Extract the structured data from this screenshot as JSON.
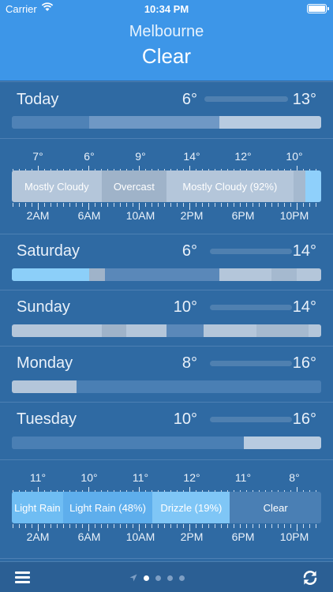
{
  "status_bar": {
    "carrier": "Carrier",
    "time": "10:34 PM"
  },
  "header": {
    "city": "Melbourne",
    "condition": "Clear"
  },
  "today": {
    "name": "Today",
    "low": "6°",
    "high": "13°",
    "bar": [
      {
        "frac": 0.25,
        "color": "#4f82b6"
      },
      {
        "frac": 0.42,
        "color": "#6f98c5"
      },
      {
        "frac": 0.33,
        "color": "#b8cbe0"
      }
    ]
  },
  "hourly_today": {
    "temps": [
      "7°",
      "6°",
      "9°",
      "14°",
      "12°",
      "10°"
    ],
    "times": [
      "2AM",
      "6AM",
      "10AM",
      "2PM",
      "6PM",
      "10PM"
    ],
    "segments": [
      {
        "label": "Mostly Cloudy",
        "frac": 0.29,
        "color": "#b4c6da"
      },
      {
        "label": "Overcast",
        "frac": 0.21,
        "color": "#9fb3c9"
      },
      {
        "label": "Mostly Cloudy (92%)",
        "frac": 0.41,
        "color": "#b4c6da"
      },
      {
        "label": "",
        "frac": 0.04,
        "color": "#a5b9cf"
      },
      {
        "label": "",
        "frac": 0.05,
        "color": "#8fd0fb"
      }
    ]
  },
  "days": [
    {
      "name": "Saturday",
      "low": "6°",
      "high": "14°",
      "bar": [
        {
          "frac": 0.25,
          "color": "#8ccff9"
        },
        {
          "frac": 0.05,
          "color": "#9fb3c9"
        },
        {
          "frac": 0.37,
          "color": "#5a88b9"
        },
        {
          "frac": 0.17,
          "color": "#b4c6da"
        },
        {
          "frac": 0.08,
          "color": "#a5b9cf"
        },
        {
          "frac": 0.08,
          "color": "#b4c6da"
        }
      ]
    },
    {
      "name": "Sunday",
      "low": "10°",
      "high": "14°",
      "bar": [
        {
          "frac": 0.29,
          "color": "#b4c6da"
        },
        {
          "frac": 0.08,
          "color": "#9fb3c9"
        },
        {
          "frac": 0.13,
          "color": "#b4c6da"
        },
        {
          "frac": 0.12,
          "color": "#5a88b9"
        },
        {
          "frac": 0.17,
          "color": "#b4c6da"
        },
        {
          "frac": 0.17,
          "color": "#a5b9cf"
        },
        {
          "frac": 0.04,
          "color": "#b4c6da"
        }
      ]
    },
    {
      "name": "Monday",
      "low": "8°",
      "high": "16°",
      "bar": [
        {
          "frac": 0.21,
          "color": "#b4c6da"
        },
        {
          "frac": 0.79,
          "color": "#4a7fb4"
        }
      ]
    },
    {
      "name": "Tuesday",
      "low": "10°",
      "high": "16°",
      "bar": [
        {
          "frac": 0.75,
          "color": "#4a7fb4"
        },
        {
          "frac": 0.25,
          "color": "#b8cbe0"
        }
      ]
    }
  ],
  "hourly_tuesday": {
    "temps": [
      "11°",
      "10°",
      "11°",
      "12°",
      "11°",
      "8°"
    ],
    "times": [
      "2AM",
      "6AM",
      "10AM",
      "2PM",
      "6PM",
      "10PM"
    ],
    "segments": [
      {
        "label": "Light Rain",
        "frac": 0.165,
        "color": "#6fbdf3"
      },
      {
        "label": "Light Rain (48%)",
        "frac": 0.29,
        "color": "#5eaeec"
      },
      {
        "label": "Drizzle (19%)",
        "frac": 0.25,
        "color": "#7fc6f6"
      },
      {
        "label": "Clear",
        "frac": 0.295,
        "color": "#4a7fb4"
      }
    ]
  },
  "tabbar": {
    "pages": 4,
    "active_page": 1
  },
  "colors": {
    "header": "#3d96e8",
    "background": "#2f6aa3"
  },
  "icons": {
    "menu": "menu-icon",
    "refresh": "refresh-icon",
    "location": "location-arrow-icon",
    "wifi": "wifi-icon",
    "battery": "battery-icon"
  }
}
